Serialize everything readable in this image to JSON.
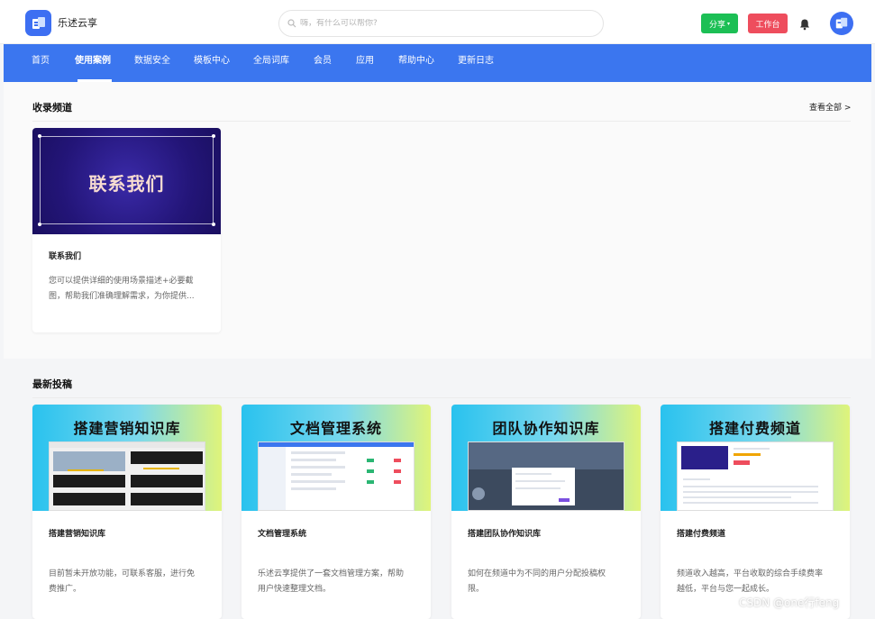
{
  "header": {
    "app_name": "乐述云享",
    "search_placeholder": "嗨，有什么可以帮你?",
    "share_label": "分享",
    "workbench_label": "工作台",
    "colors": {
      "brand": "#3b76ef",
      "share": "#1cbf55",
      "workbench": "#ee4d5d"
    }
  },
  "nav": {
    "items": [
      {
        "label": "首页"
      },
      {
        "label": "使用案例"
      },
      {
        "label": "数据安全"
      },
      {
        "label": "模板中心"
      },
      {
        "label": "全局词库"
      },
      {
        "label": "会员"
      },
      {
        "label": "应用"
      },
      {
        "label": "帮助中心"
      },
      {
        "label": "更新日志"
      }
    ],
    "active": "使用案例"
  },
  "collected": {
    "title": "收录频道",
    "view_all": "查看全部 >",
    "cards": [
      {
        "cover_text": "联系我们",
        "title": "联系我们",
        "desc_line1": "您可以提供详细的使用场景描述+必要截",
        "desc_line2": "图，帮助我们准确理解需求，为你提供..."
      }
    ]
  },
  "latest": {
    "title": "最新投稿",
    "cards": [
      {
        "cover_text": "搭建营销知识库",
        "title": "搭建营销知识库",
        "desc_line1": "目前暂未开放功能，可联系客服，进行免",
        "desc_line2": "费推广。"
      },
      {
        "cover_text": "文档管理系统",
        "title": "文档管理系统",
        "desc_line1": "乐述云享提供了一套文档管理方案，帮助",
        "desc_line2": "用户快速整理文档。"
      },
      {
        "cover_text": "团队协作知识库",
        "title": "搭建团队协作知识库",
        "desc_line1": "如何在频道中为不同的用户分配投稿权",
        "desc_line2": "限。"
      },
      {
        "cover_text": "搭建付费频道",
        "title": "搭建付费频道",
        "desc_line1": "频道收入越高，平台收取的综合手续费率",
        "desc_line2": "越低，平台与您一起成长。"
      }
    ]
  },
  "watermark": "CSDN @one行feng"
}
